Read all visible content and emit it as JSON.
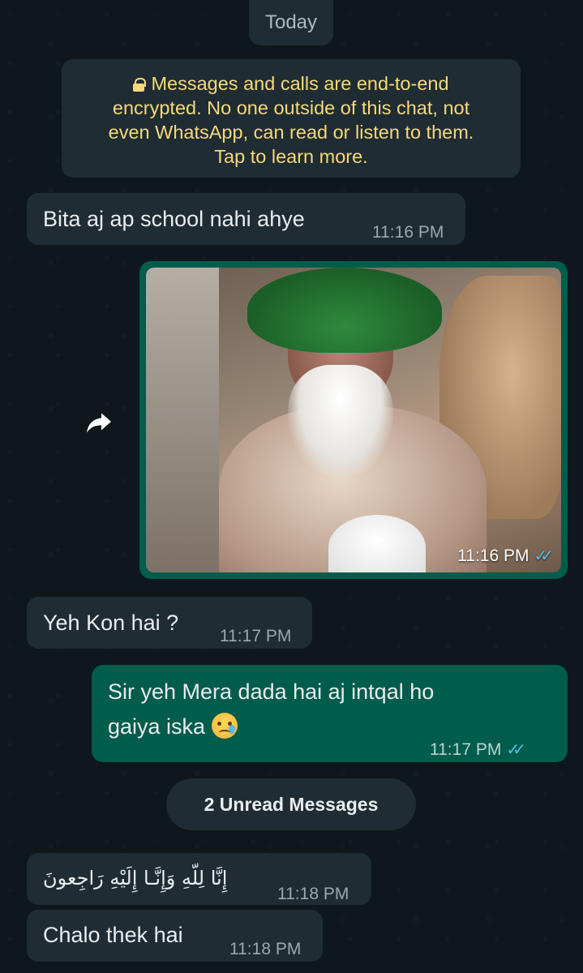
{
  "date_label": "Today",
  "encryption_notice": {
    "line1": "Messages and calls are end-to-end",
    "line2": "encrypted. No one outside of this chat, not",
    "line3": "even WhatsApp, can read or listen to them.",
    "line4": "Tap to learn more."
  },
  "messages": [
    {
      "direction": "incoming",
      "text": "Bita aj ap school nahi ahye",
      "time": "11:16 PM"
    },
    {
      "direction": "outgoing",
      "type": "image",
      "time": "11:16 PM",
      "status": "read"
    },
    {
      "direction": "incoming",
      "text": "Yeh Kon hai ?",
      "time": "11:17 PM"
    },
    {
      "direction": "outgoing",
      "text_line1": "Sir yeh Mera dada hai aj intqal ho",
      "text_line2": "gaiya iska",
      "emoji": "crying-face",
      "time": "11:17 PM",
      "status": "read"
    },
    {
      "direction": "incoming",
      "text": "إِنَّا لِلّهِ وَإِنَّـا إِلَيْهِ رَاجِعونَ",
      "time": "11:18 PM"
    },
    {
      "direction": "incoming",
      "text": "Chalo thek hai",
      "time": "11:18 PM"
    }
  ],
  "unread_label": "2 Unread Messages",
  "read_ticks": "✓✓",
  "colors": {
    "incoming_bubble": "#1f2c33",
    "outgoing_bubble": "#005c4b",
    "read_tick": "#53bdeb",
    "notice_text": "#f5d97a"
  }
}
